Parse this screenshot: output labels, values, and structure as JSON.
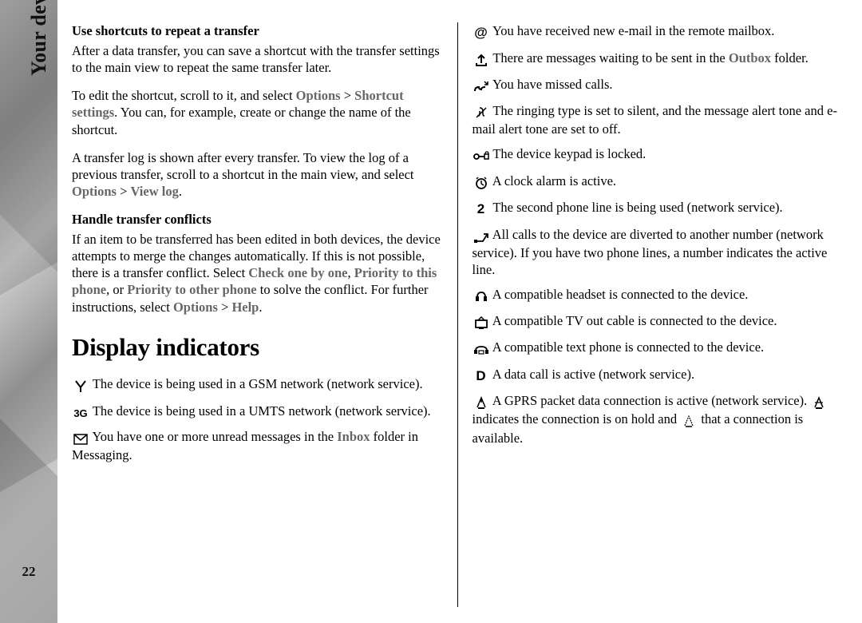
{
  "side": {
    "label": "Your device",
    "page_num": "22"
  },
  "left": {
    "h_shortcuts": "Use shortcuts to repeat a transfer",
    "p1": "After a data transfer, you can save a shortcut with the transfer settings to the main view to repeat the same transfer later.",
    "p2a": "To edit the shortcut, scroll to it, and select ",
    "p2b": "Options",
    "p2c": " > ",
    "p2d": "Shortcut settings",
    "p2e": ". You can, for example, create or change the name of the shortcut.",
    "p3a": "A transfer log is shown after every transfer. To view the log of a previous transfer, scroll to a shortcut in the main view, and select ",
    "p3b": "Options",
    "p3c": " > ",
    "p3d": "View log",
    "p3e": ".",
    "h_conflicts": "Handle transfer conflicts",
    "p4a": "If an item to be transferred has been edited in both devices, the device attempts to merge the changes automatically. If this is not possible, there is a transfer conflict. Select ",
    "p4b": "Check one by one",
    "p4c": ", ",
    "p4d": "Priority to this phone",
    "p4e": ", or ",
    "p4f": "Priority to other phone",
    "p4g": " to solve the conflict. For further instructions, select ",
    "p4h": "Options",
    "p4i": " > ",
    "p4j": "Help",
    "p4k": ".",
    "h_display": "Display indicators",
    "ind_gsm": " The device is being used in a GSM network (network service).",
    "ind_3g": " The device is being used in a UMTS network (network service).",
    "ind_inbox_a": " You have one or more unread messages in the ",
    "ind_inbox_b": "Inbox",
    "ind_inbox_c": " folder in Messaging."
  },
  "right": {
    "ind_email": " You have received new e-mail in the remote mailbox.",
    "ind_outbox_a": " There are messages waiting to be sent in the ",
    "ind_outbox_b": "Outbox",
    "ind_outbox_c": " folder.",
    "ind_missed": " You have missed calls.",
    "ind_silent": " The ringing type is set to silent, and the message alert tone and e-mail alert tone are set to off.",
    "ind_locked": " The device keypad is locked.",
    "ind_alarm": " A clock alarm is active.",
    "ind_line2": " The second phone line is being used (network service).",
    "ind_divert": " All calls to the device are diverted to another number (network service). If you have two phone lines, a number indicates the active line.",
    "ind_headset": " A compatible headset is connected to the device.",
    "ind_tvout": " A compatible TV out cable is connected to the device.",
    "ind_textphone": " A compatible text phone is connected to the device.",
    "ind_datacall": " A data call is active (network service).",
    "ind_gprs_a": " A GPRS packet data connection is active (network service). ",
    "ind_gprs_b": " indicates the connection is on hold and ",
    "ind_gprs_c": " that a connection is available."
  }
}
